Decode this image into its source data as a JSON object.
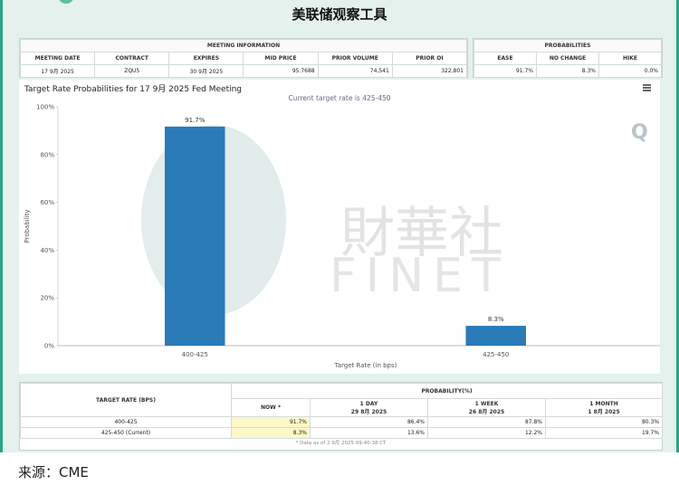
{
  "page_title": "美联储观察工具",
  "meeting_info": {
    "heading": "MEETING INFORMATION",
    "columns": [
      "MEETING DATE",
      "CONTRACT",
      "EXPIRES",
      "MID PRICE",
      "PRIOR VOLUME",
      "PRIOR OI"
    ],
    "row": [
      "17 9月 2025",
      "ZQU5",
      "30 9月 2025",
      "95.7688",
      "74,541",
      "322,801"
    ]
  },
  "probabilities": {
    "heading": "PROBABILITIES",
    "columns": [
      "EASE",
      "NO CHANGE",
      "HIKE"
    ],
    "row": [
      "91.7%",
      "8.3%",
      "0.0%"
    ]
  },
  "chart": {
    "title": "Target Rate Probabilities for 17 9月 2025 Fed Meeting",
    "subtitle": "Current target rate is 425-450",
    "menu_icon": "hamburger-menu-icon",
    "watermark_cn": "財華社",
    "watermark_en": "FINET",
    "watermark_q": "Q",
    "bar_color": "#2a7ab8"
  },
  "chart_data": {
    "type": "bar",
    "title": "Target Rate Probabilities for 17 9月 2025 Fed Meeting",
    "subtitle": "Current target rate is 425-450",
    "xlabel": "Target Rate (in bps)",
    "ylabel": "Probability",
    "categories": [
      "400-425",
      "425-450"
    ],
    "values": [
      91.7,
      8.3
    ],
    "data_labels": [
      "91.7%",
      "8.3%"
    ],
    "ylim": [
      0,
      100
    ],
    "yticks": [
      0,
      20,
      40,
      60,
      80,
      100
    ],
    "ytick_labels": [
      "0%",
      "20%",
      "40%",
      "60%",
      "80%",
      "100%"
    ],
    "grid": false,
    "legend": "none"
  },
  "bottom_table": {
    "rate_header": "TARGET RATE (BPS)",
    "prob_header": "PROBABILITY(%)",
    "columns": [
      {
        "line1": "NOW *",
        "line2": ""
      },
      {
        "line1": "1 DAY",
        "line2": "29 8月 2025"
      },
      {
        "line1": "1 WEEK",
        "line2": "26 8月 2025"
      },
      {
        "line1": "1 MONTH",
        "line2": "1 8月 2025"
      }
    ],
    "rows": [
      {
        "rate": "400-425",
        "values": [
          "91.7%",
          "86.4%",
          "87.8%",
          "80.3%"
        ]
      },
      {
        "rate": "425-450 (Current)",
        "values": [
          "8.3%",
          "13.6%",
          "12.2%",
          "19.7%"
        ]
      }
    ],
    "footnote": "* Data as of 2 9月 2025 09:40:38 CT"
  },
  "source_text": "来源：CME"
}
